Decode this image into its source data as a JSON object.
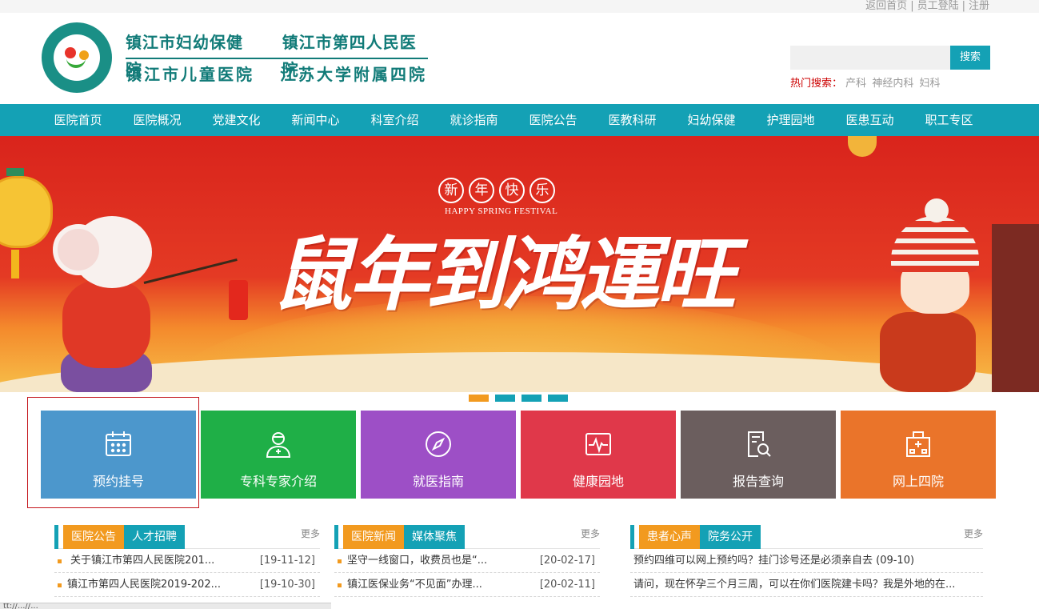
{
  "toplinks": [
    "返回首页",
    "|",
    "员工登陆",
    "|",
    "注册"
  ],
  "logo": {
    "names_row1": [
      "镇江市妇幼保健院",
      "镇江市第四人民医院"
    ],
    "names_row2": [
      "镇江市儿童医院",
      "江苏大学附属四院"
    ],
    "seal_text": "镇江市妇幼保健院 镇江市第四人民医院"
  },
  "search": {
    "placeholder": "",
    "button": "搜索",
    "hot_label": "热门搜索：",
    "keywords": [
      "产科",
      "神经内科",
      "妇科"
    ]
  },
  "nav": [
    "医院首页",
    "医院概况",
    "党建文化",
    "新闻中心",
    "科室介绍",
    "就诊指南",
    "医院公告",
    "医教科研",
    "妇幼保健",
    "护理园地",
    "医患互动",
    "职工专区"
  ],
  "banner": {
    "greeting_chars": [
      "新",
      "年",
      "快",
      "乐"
    ],
    "greeting_en": "HAPPY SPRING FESTIVAL",
    "calligraphy": "鼠年到鸿運旺",
    "slides": 4,
    "active_slide": 1
  },
  "services": [
    {
      "label": "预约挂号",
      "icon": "calendar-icon",
      "color": "#4c97cc"
    },
    {
      "label": "专科专家介绍",
      "icon": "doctor-icon",
      "color": "#1faf47"
    },
    {
      "label": "就医指南",
      "icon": "compass-icon",
      "color": "#9d4fc6"
    },
    {
      "label": "健康园地",
      "icon": "heartbeat-icon",
      "color": "#e0384a"
    },
    {
      "label": "报告查询",
      "icon": "report-search-icon",
      "color": "#6b5e5e"
    },
    {
      "label": "网上四院",
      "icon": "hospital-icon",
      "color": "#ea742a"
    }
  ],
  "columns": [
    {
      "tabs": [
        "医院公告",
        "人才招聘"
      ],
      "more": "更多",
      "items": [
        {
          "title": "关于镇江市第四人民医院201...",
          "date": "[19-11-12]"
        },
        {
          "title": "镇江市第四人民医院2019-202...",
          "date": "[19-10-30]"
        }
      ]
    },
    {
      "tabs": [
        "医院新闻",
        "媒体聚焦"
      ],
      "more": "更多",
      "items": [
        {
          "title": "坚守一线窗口，收费员也是“...",
          "date": "[20-02-17]"
        },
        {
          "title": "镇江医保业务“不见面”办理...",
          "date": "[20-02-11]"
        }
      ]
    },
    {
      "tabs": [
        "患者心声",
        "院务公开"
      ],
      "more": "更多",
      "items": [
        {
          "title": "预约四维可以网上预约吗？挂门诊号还是必须亲自去 (09-10)",
          "date": ""
        },
        {
          "title": "请问，现在怀孕三个月三周，可以在你们医院建卡吗？我是外地的在...",
          "date": ""
        }
      ]
    }
  ],
  "status_bar": "tt://...//..."
}
